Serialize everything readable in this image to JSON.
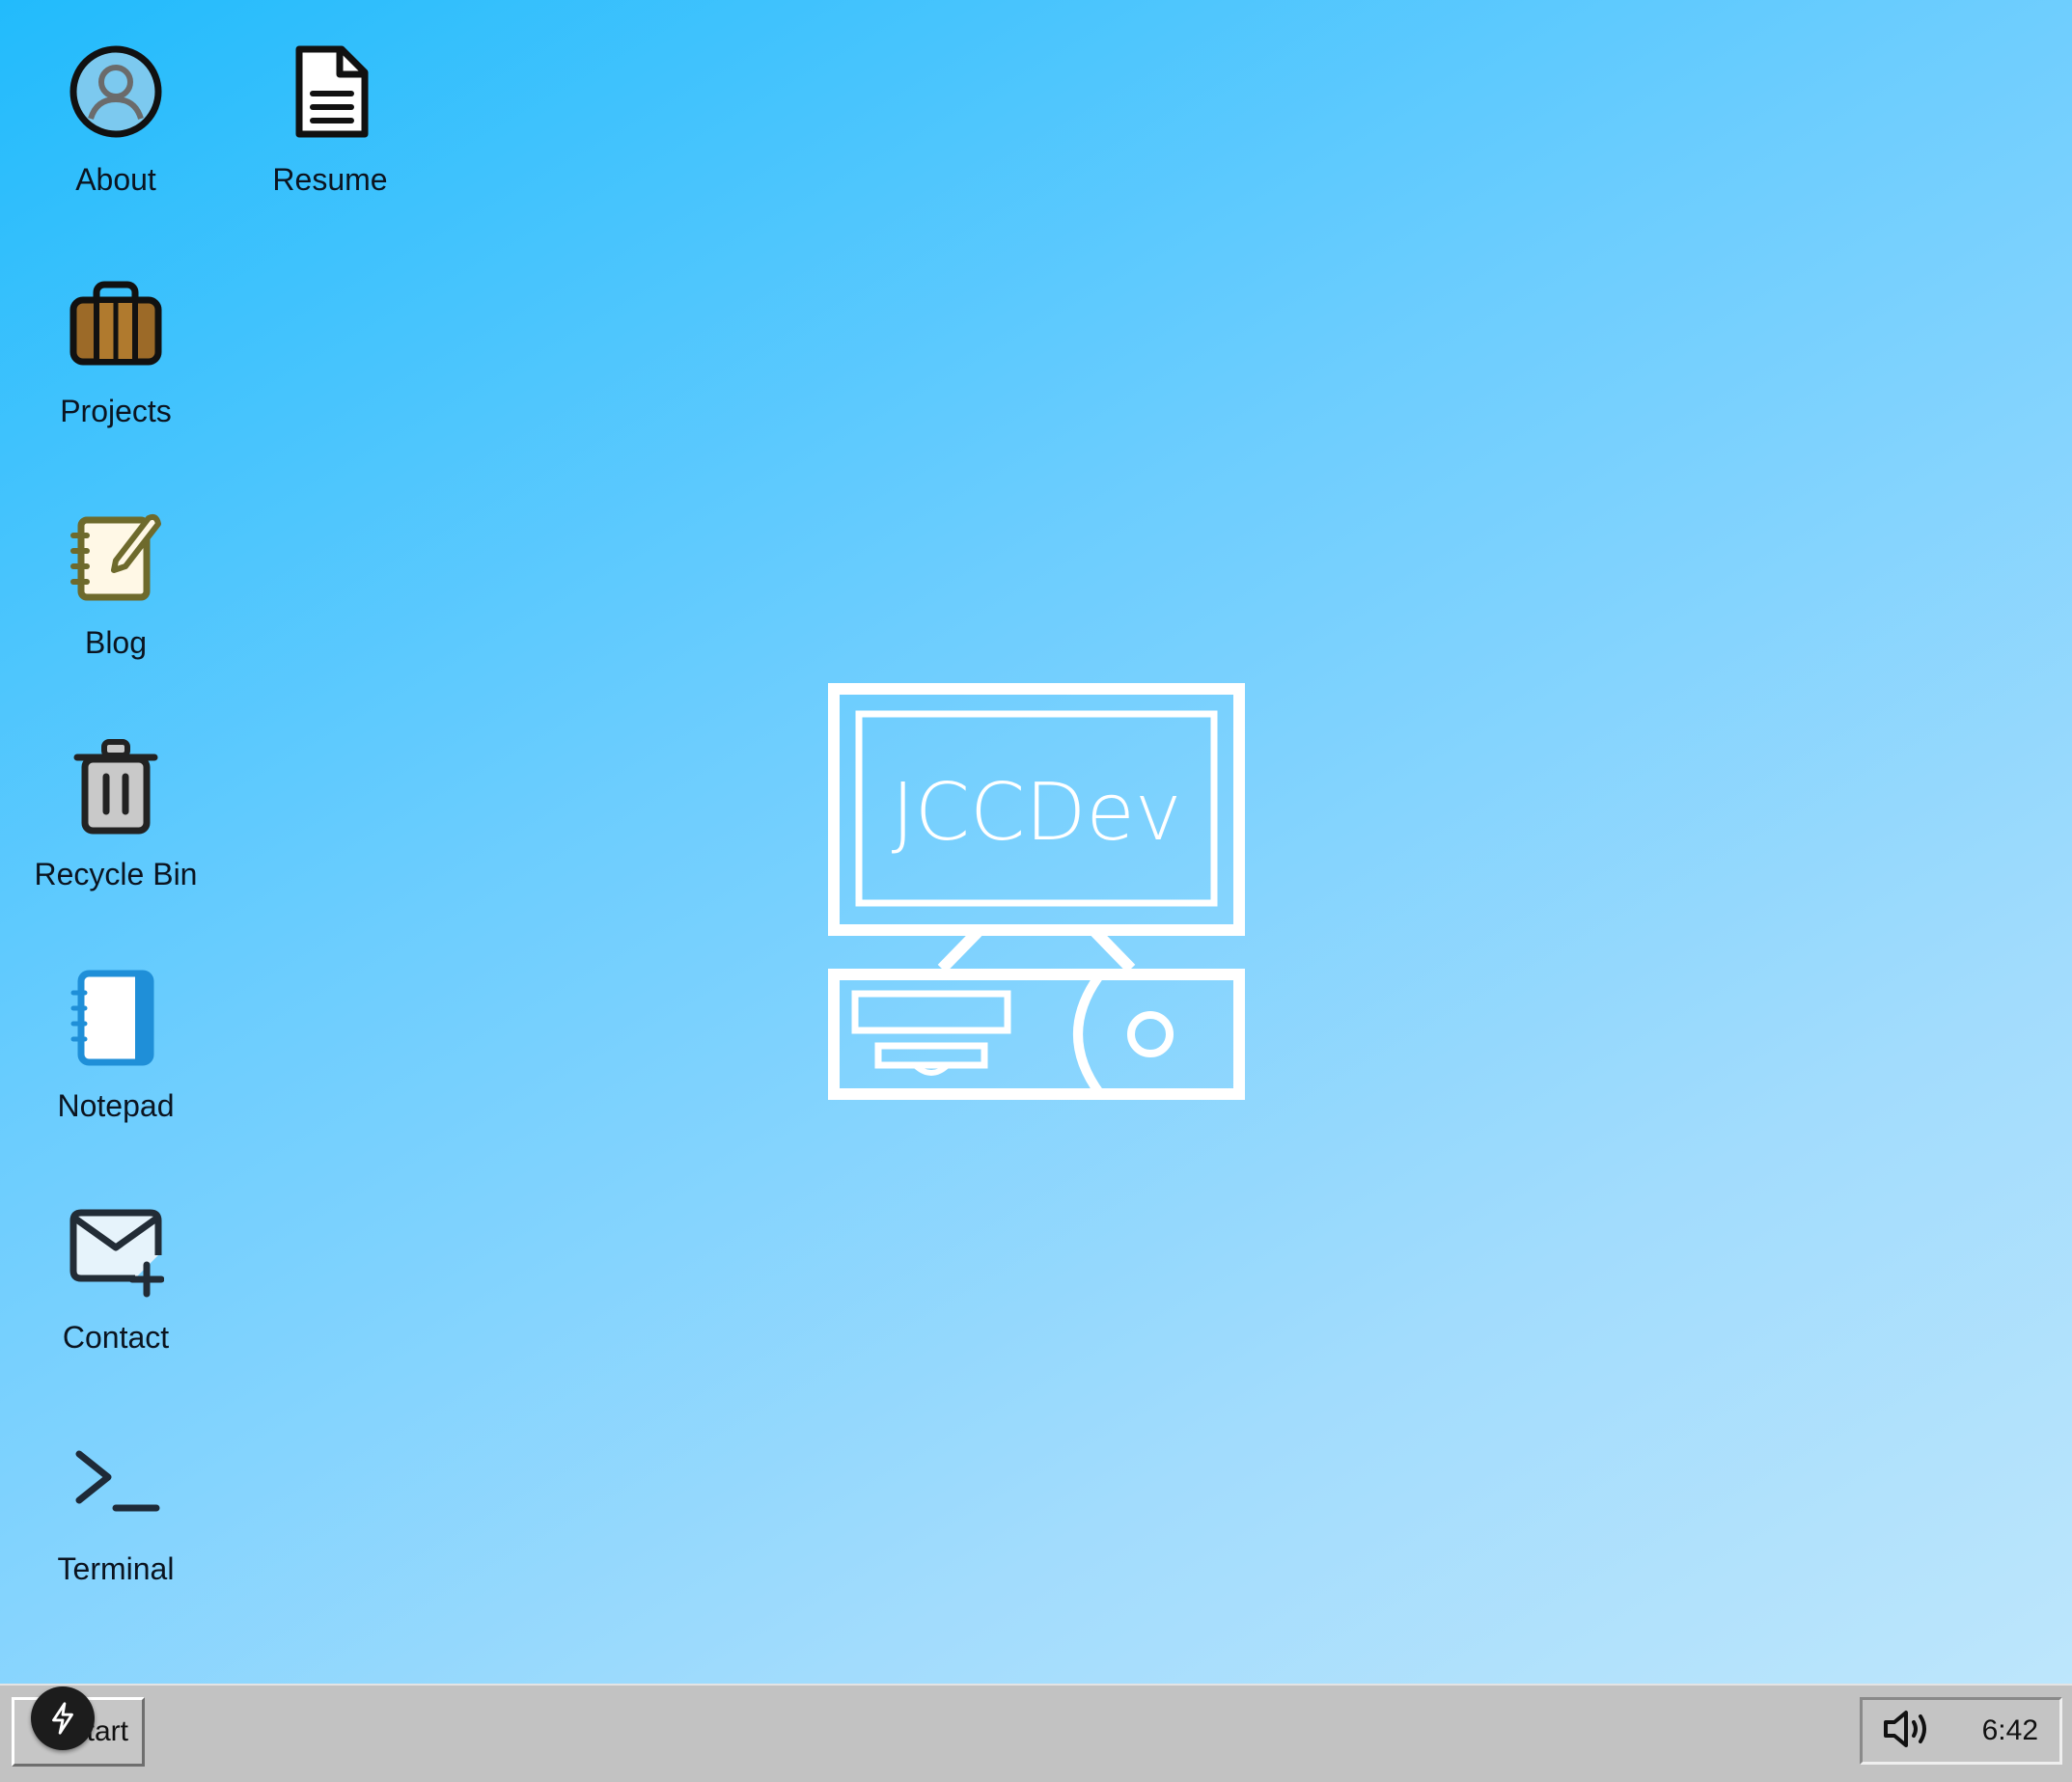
{
  "desktop": {
    "icons": [
      {
        "label": "About",
        "icon": "user-profile-icon"
      },
      {
        "label": "Resume",
        "icon": "document-icon"
      },
      {
        "label": "Projects",
        "icon": "briefcase-icon"
      },
      {
        "label": "Blog",
        "icon": "notebook-pen-icon"
      },
      {
        "label": "Recycle Bin",
        "icon": "trash-icon"
      },
      {
        "label": "Notepad",
        "icon": "notepad-icon"
      },
      {
        "label": "Contact",
        "icon": "mail-plus-icon"
      },
      {
        "label": "Terminal",
        "icon": "terminal-icon"
      }
    ],
    "logo": {
      "text": "JCCDev",
      "icon": "computer-logo-icon"
    },
    "background_colors": [
      "#22bbfc",
      "#bde6fc"
    ]
  },
  "taskbar": {
    "start_label": "Start",
    "start_badge_icon": "lightning-icon",
    "volume_icon": "volume-icon",
    "clock": "6:42"
  }
}
